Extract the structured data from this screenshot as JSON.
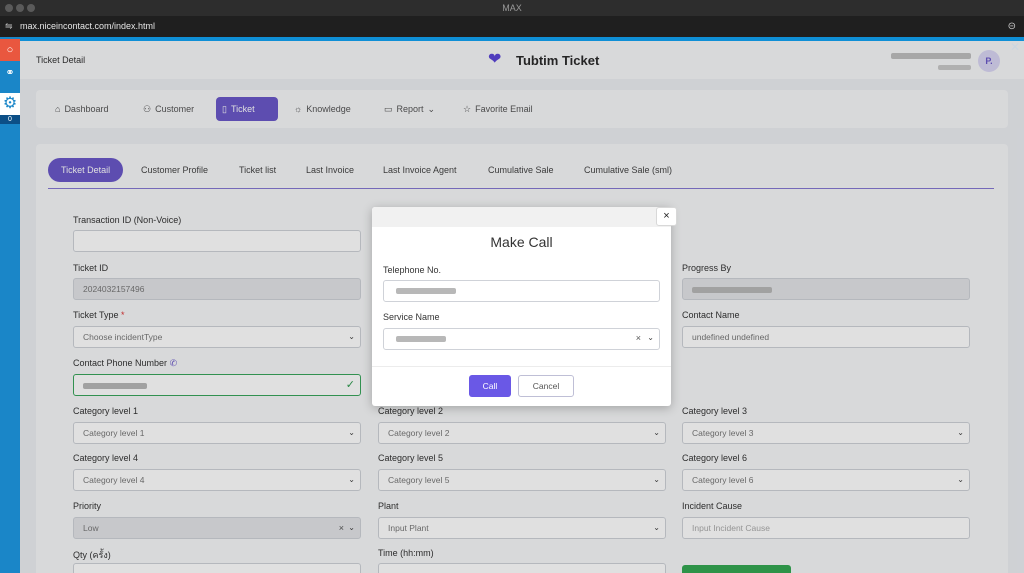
{
  "window": {
    "title": "MAX"
  },
  "browser": {
    "url": "max.niceincontact.com/index.html"
  },
  "agent_strip": {
    "counter": "0"
  },
  "header": {
    "page_title": "Ticket Detail",
    "brand": "Tubtim Ticket",
    "avatar_initial": "P."
  },
  "nav": {
    "items": [
      {
        "label": "Dashboard",
        "icon": "home-icon"
      },
      {
        "label": "Customer",
        "icon": "users-icon"
      },
      {
        "label": "Ticket",
        "icon": "book-icon",
        "active": true
      },
      {
        "label": "Knowledge",
        "icon": "sun-icon"
      },
      {
        "label": "Report",
        "icon": "document-icon"
      },
      {
        "label": "Favorite Email",
        "icon": "star-icon"
      }
    ]
  },
  "subtabs": [
    "Ticket Detail",
    "Customer Profile",
    "Ticket list",
    "Last Invoice",
    "Last Invoice Agent",
    "Cumulative Sale",
    "Cumulative Sale (sml)"
  ],
  "form": {
    "transaction_id_label": "Transaction ID (Non-Voice)",
    "transaction_id_value": "",
    "ticket_id_label": "Ticket ID",
    "ticket_id_value": "2024032157496",
    "progress_by_label": "Progress By",
    "ticket_type_label": "Ticket Type",
    "ticket_type_required": "*",
    "ticket_type_placeholder": "Choose incidentType",
    "contact_name_label": "Contact Name",
    "contact_name_value": "undefined undefined",
    "contact_phone_label": "Contact Phone Number",
    "cat1_label": "Category level 1",
    "cat1_value": "Category level 1",
    "cat2_label": "Category level 2",
    "cat2_value": "Category level 2",
    "cat3_label": "Category level 3",
    "cat3_value": "Category level 3",
    "cat4_label": "Category level 4",
    "cat4_value": "Category level 4",
    "cat5_label": "Category level 5",
    "cat5_value": "Category level 5",
    "cat6_label": "Category level 6",
    "cat6_value": "Category level 6",
    "priority_label": "Priority",
    "priority_value": "Low",
    "plant_label": "Plant",
    "plant_placeholder": "Input Plant",
    "incident_cause_label": "Incident Cause",
    "incident_cause_placeholder": "Input Incident Cause",
    "qty_label": "Qty (ครั้ง)",
    "time_label": "Time (hh:mm)"
  },
  "modal": {
    "title": "Make Call",
    "telephone_label": "Telephone No.",
    "service_label": "Service Name",
    "call_button": "Call",
    "cancel_button": "Cancel",
    "close_symbol": "×"
  }
}
